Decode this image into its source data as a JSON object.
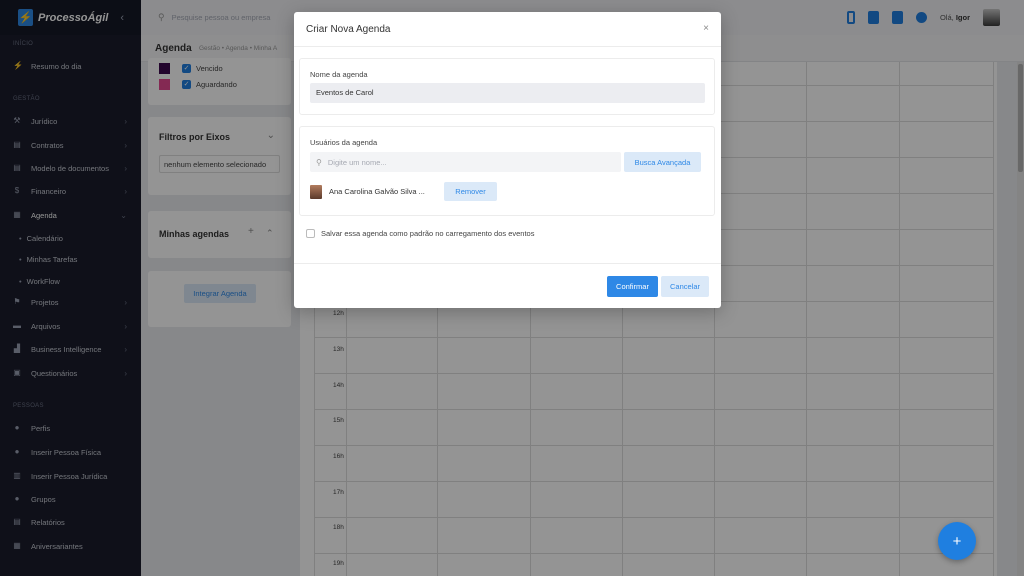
{
  "app": {
    "logo_text": "ProcessoÁgil",
    "collapse_icon": "chevron-left-icon"
  },
  "sidebar": {
    "sections": [
      {
        "title": "INÍCIO"
      },
      {
        "title": "GESTÃO"
      },
      {
        "title": "PESSOAS"
      }
    ],
    "items": [
      {
        "label": "Resumo do dia",
        "icon": "bolt-icon"
      },
      {
        "label": "Jurídico",
        "icon": "gavel-icon",
        "arrow": "›"
      },
      {
        "label": "Contratos",
        "icon": "file-icon",
        "arrow": "›"
      },
      {
        "label": "Modelo de documentos",
        "icon": "file-icon",
        "arrow": "›"
      },
      {
        "label": "Financeiro",
        "icon": "dollar-icon",
        "arrow": "›"
      },
      {
        "label": "Agenda",
        "icon": "calendar-icon",
        "arrow": "⌄"
      },
      {
        "label": "Projetos",
        "icon": "project-icon",
        "arrow": "›"
      },
      {
        "label": "Arquivos",
        "icon": "folder-icon",
        "arrow": "›"
      },
      {
        "label": "Business Intelligence",
        "icon": "chart-icon",
        "arrow": "›"
      },
      {
        "label": "Questionários",
        "icon": "questionnaire-icon",
        "arrow": "›"
      },
      {
        "label": "Perfis",
        "icon": "user-icon"
      },
      {
        "label": "Inserir Pessoa Física",
        "icon": "user-plus-icon"
      },
      {
        "label": "Inserir Pessoa Jurídica",
        "icon": "building-icon"
      },
      {
        "label": "Grupos",
        "icon": "users-icon"
      },
      {
        "label": "Relatórios",
        "icon": "report-icon"
      },
      {
        "label": "Aniversariantes",
        "icon": "gift-icon"
      }
    ],
    "subitems": [
      {
        "label": "Calendário"
      },
      {
        "label": "Minhas Tarefas"
      },
      {
        "label": "WorkFlow"
      }
    ]
  },
  "topbar": {
    "search_placeholder": "Pesquise pessoa ou empresa",
    "greeting_prefix": "Olá,",
    "user_name": "Igor"
  },
  "subheader": {
    "title": "Agenda",
    "breadcrumb": "Gestão  •  Agenda  •  Minha A"
  },
  "filters": {
    "legend": [
      {
        "label": "Vencido",
        "color": "#3d0a4f"
      },
      {
        "label": "Aguardando",
        "color": "#e3478f"
      }
    ],
    "eixos": {
      "title": "Filtros por Eixos",
      "selected": "nenhum elemento selecionado"
    },
    "minhas": {
      "title": "Minhas agendas",
      "add": "+",
      "toggle": "⌃"
    },
    "integrar_label": "Integrar Agenda"
  },
  "calendar": {
    "hours": [
      "12h",
      "13h",
      "14h",
      "15h",
      "16h",
      "17h",
      "18h",
      "19h"
    ]
  },
  "modal": {
    "title": "Criar Nova Agenda",
    "close": "×",
    "name_label": "Nome da agenda",
    "name_value": "Eventos de Carol",
    "users_label": "Usuários da agenda",
    "user_search_placeholder": "Digite um nome...",
    "busca_label": "Busca Avançada",
    "users": [
      {
        "name": "Ana Carolina Galvão Silva ..."
      }
    ],
    "remove_label": "Remover",
    "save_default_label": "Salvar essa agenda como padrão no carregamento dos eventos",
    "confirm_label": "Confirmar",
    "cancel_label": "Cancelar"
  },
  "fab": {
    "label": "+"
  },
  "colors": {
    "accent": "#2e88e6",
    "sidebar_bg": "#1a1d2b",
    "soft_accent": "#dbe9f8"
  }
}
